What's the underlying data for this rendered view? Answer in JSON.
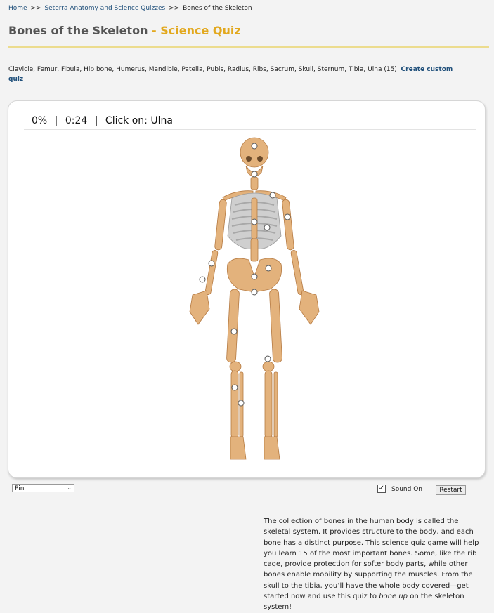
{
  "breadcrumb": {
    "home": "Home",
    "sep1": ">>",
    "section": "Seterra Anatomy and Science Quizzes",
    "sep2": ">>",
    "current": "Bones of the Skeleton"
  },
  "title": {
    "main": "Bones of the Skeleton",
    "accent": " - Science Quiz"
  },
  "bone_list": {
    "text": "Clavicle, Femur, Fibula, Hip bone, Humerus, Mandible, Patella, Pubis, Radius, Ribs, Sacrum, Skull, Sternum, Tibia, Ulna (15)",
    "custom_link": "Create custom quiz"
  },
  "quiz": {
    "progress": "0%",
    "sep1": "|",
    "timer": "0:24",
    "sep2": "|",
    "prompt": "Click on: Ulna",
    "bone_color": "#e3b27c",
    "bone_shade": "#c98d52",
    "rib_color": "#c9c9c9",
    "marker_count": 15
  },
  "controls": {
    "mode_value": "Pin",
    "sound_checked": true,
    "sound_label": "Sound On",
    "restart_label": "Restart"
  },
  "description": {
    "part1": "The collection of bones in the human body is called the skeletal system. It provides structure to the body, and each bone has a distinct purpose. This science quiz game will help you learn 15 of the most important bones. Some, like the rib cage, provide protection for softer body parts, while other bones enable mobility by supporting the muscles. From the skull to the tibia, you’ll have the whole body covered—get started now and use this quiz to ",
    "emph": "bone up",
    "part2": " on the skeleton system!"
  }
}
